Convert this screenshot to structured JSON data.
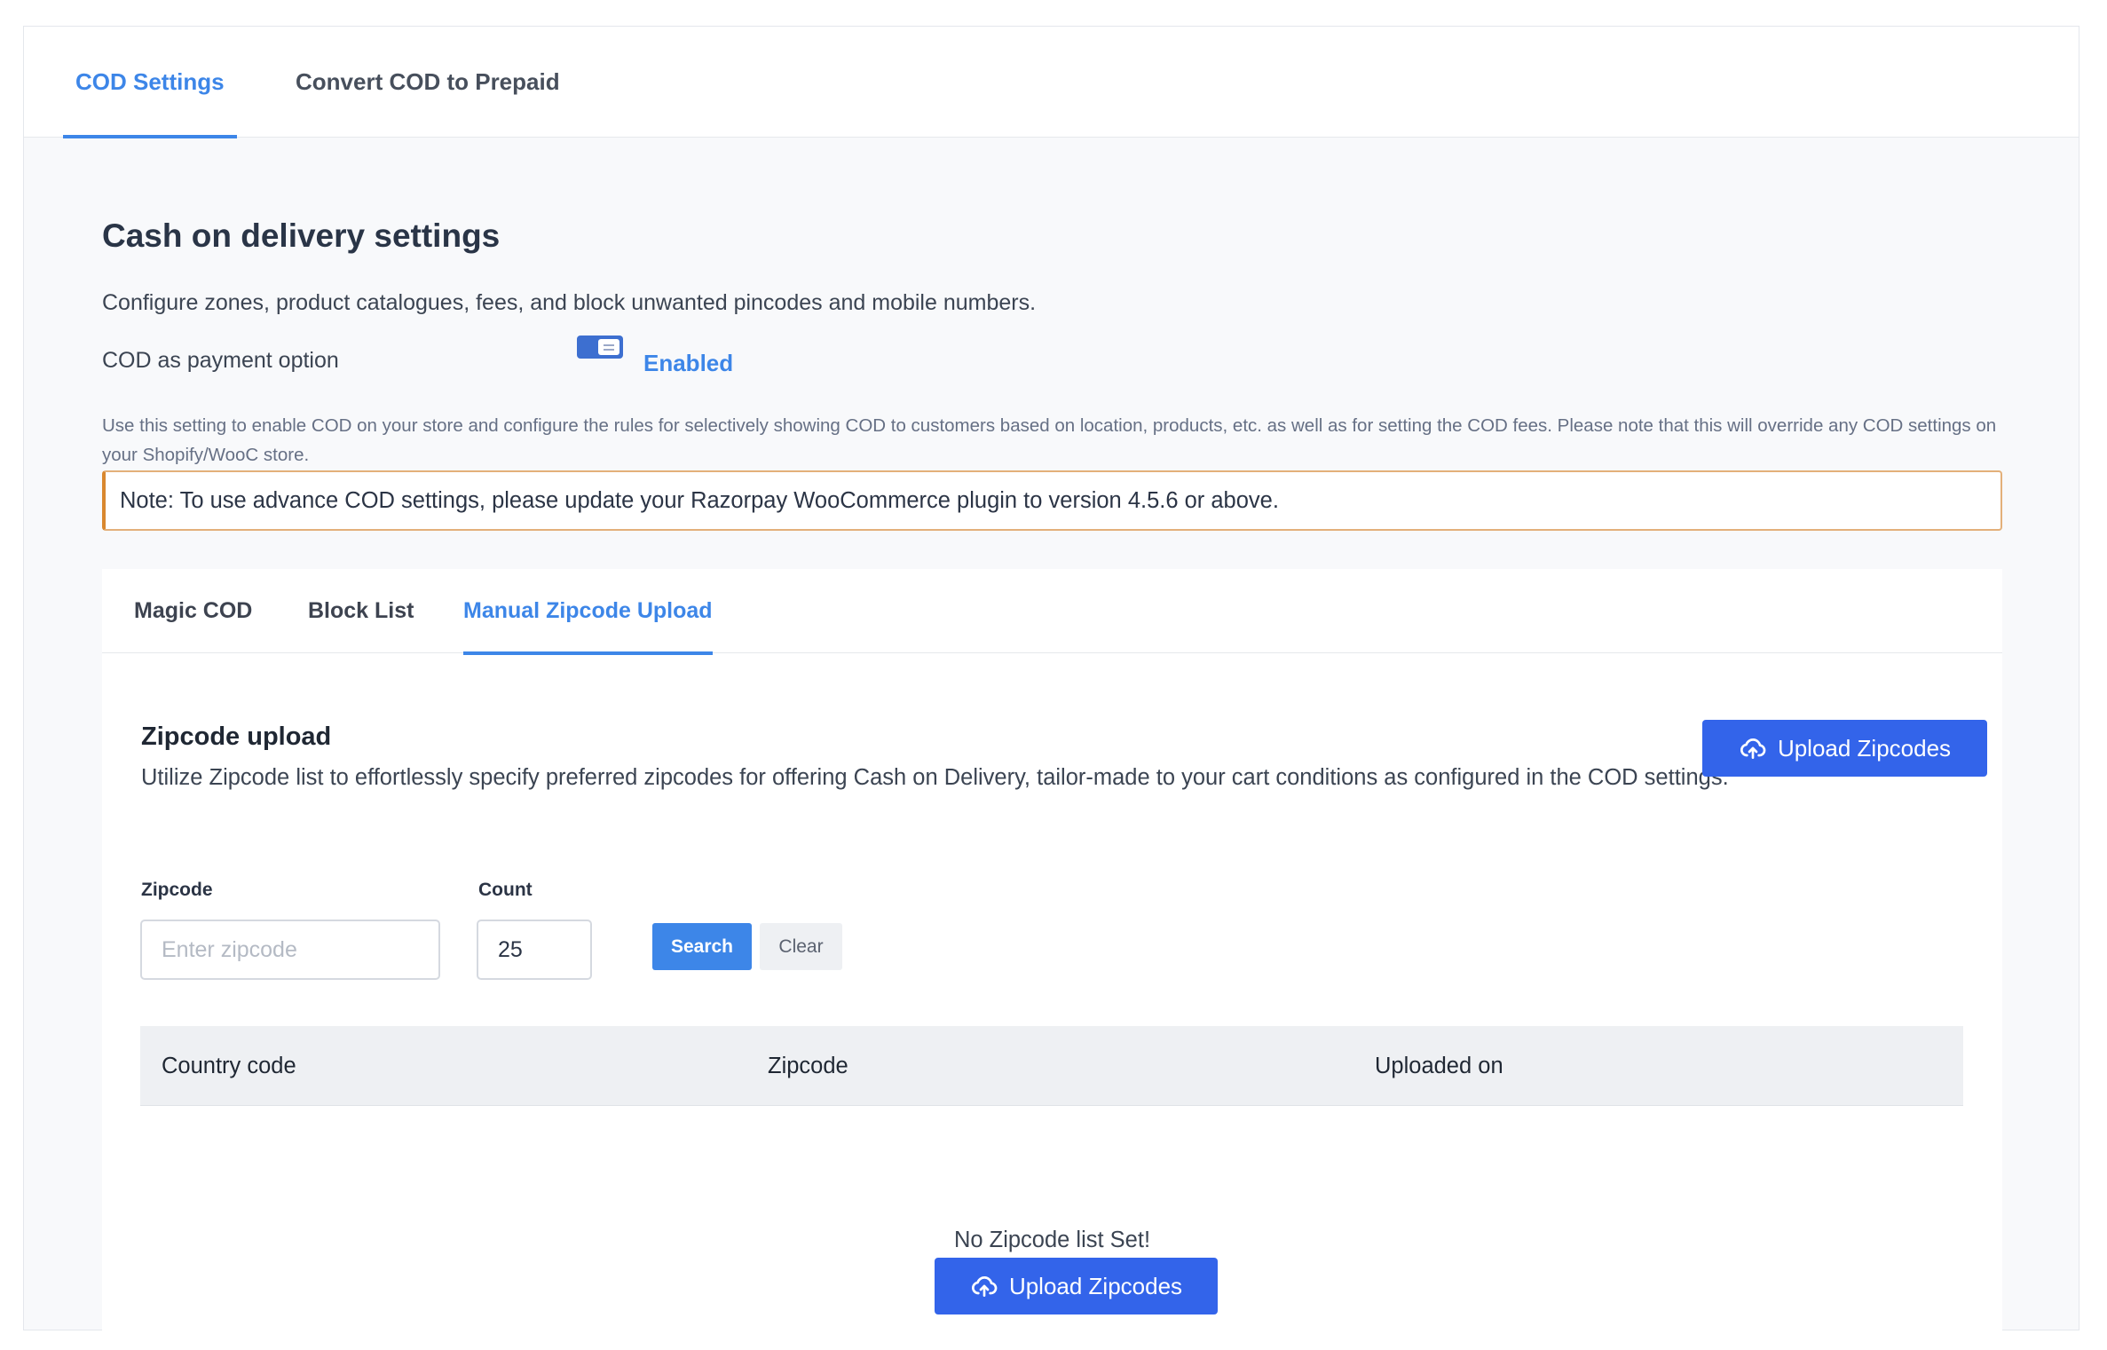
{
  "top_tabs": {
    "cod_settings": "COD Settings",
    "convert_cod": "Convert COD to Prepaid"
  },
  "header": {
    "title": "Cash on delivery settings",
    "subtitle": "Configure zones, product catalogues, fees, and block unwanted pincodes and mobile numbers."
  },
  "cod_option": {
    "label": "COD as payment option",
    "toggle_state": "Enabled",
    "help_text": "Use this setting to enable COD on your store and configure the rules for selectively showing COD to customers based on location, products, etc. as well as for setting the COD fees. Please note that this will override any COD settings on your Shopify/WooC store."
  },
  "note": "Note: To use advance COD settings, please update your Razorpay WooCommerce plugin to version 4.5.6 or above.",
  "sub_tabs": {
    "magic_cod": "Magic COD",
    "block_list": "Block List",
    "manual_upload": "Manual Zipcode Upload"
  },
  "zipcode_upload": {
    "title": "Zipcode upload",
    "description": "Utilize Zipcode list to effortlessly specify preferred zipcodes for offering Cash on Delivery, tailor-made to your cart conditions as configured in the COD settings.",
    "upload_button": "Upload Zipcodes"
  },
  "filters": {
    "zipcode_label": "Zipcode",
    "zipcode_placeholder": "Enter zipcode",
    "count_label": "Count",
    "count_value": "25",
    "search_button": "Search",
    "clear_button": "Clear"
  },
  "table": {
    "columns": [
      "Country code",
      "Zipcode",
      "Uploaded on"
    ],
    "empty_message": "No Zipcode list Set!",
    "empty_upload_button": "Upload Zipcodes"
  },
  "colors": {
    "accent": "#3d86e8",
    "upload_button": "#3364ea",
    "note_border": "#d9882f"
  },
  "icons": {
    "upload": "cloud-upload-icon",
    "toggle": "toggle-switch"
  }
}
